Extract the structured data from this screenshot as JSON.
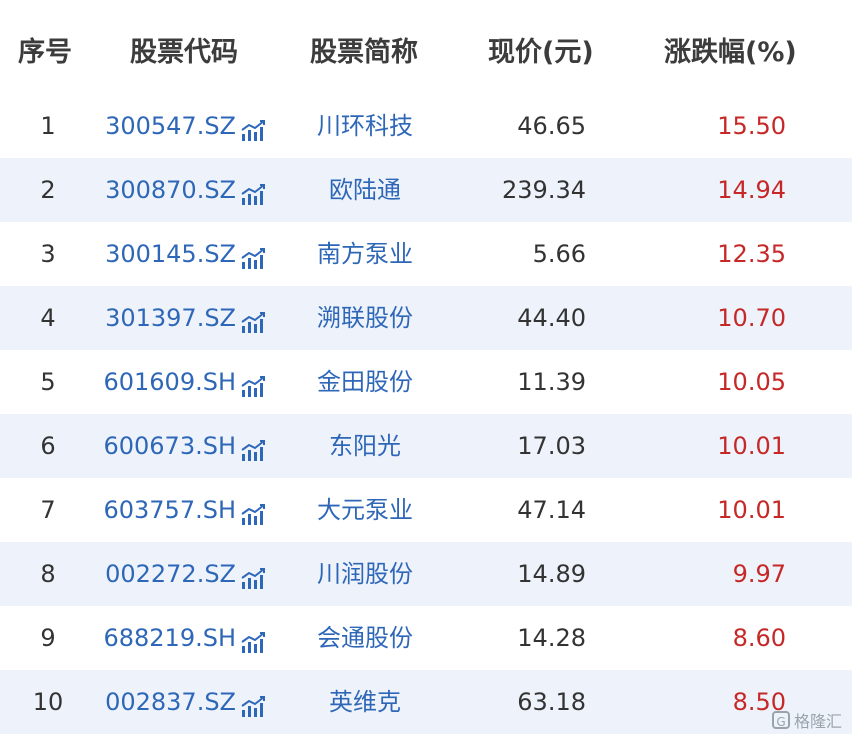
{
  "columns": {
    "index": "序号",
    "code": "股票代码",
    "name": "股票简称",
    "price": "现价(元)",
    "change": "涨跌幅(%)"
  },
  "icons": {
    "chart_icon": "trend-chart-icon",
    "icon_color": "#2f67b8"
  },
  "colors": {
    "code_link": "#2f67b8",
    "up": "#c62828",
    "stripe": "#eef3fb"
  },
  "rows": [
    {
      "index": "1",
      "code": "300547.SZ",
      "name": "川环科技",
      "price": "46.65",
      "change": "15.50"
    },
    {
      "index": "2",
      "code": "300870.SZ",
      "name": "欧陆通",
      "price": "239.34",
      "change": "14.94"
    },
    {
      "index": "3",
      "code": "300145.SZ",
      "name": "南方泵业",
      "price": "5.66",
      "change": "12.35"
    },
    {
      "index": "4",
      "code": "301397.SZ",
      "name": "溯联股份",
      "price": "44.40",
      "change": "10.70"
    },
    {
      "index": "5",
      "code": "601609.SH",
      "name": "金田股份",
      "price": "11.39",
      "change": "10.05"
    },
    {
      "index": "6",
      "code": "600673.SH",
      "name": "东阳光",
      "price": "17.03",
      "change": "10.01"
    },
    {
      "index": "7",
      "code": "603757.SH",
      "name": "大元泵业",
      "price": "47.14",
      "change": "10.01"
    },
    {
      "index": "8",
      "code": "002272.SZ",
      "name": "川润股份",
      "price": "14.89",
      "change": "9.97"
    },
    {
      "index": "9",
      "code": "688219.SH",
      "name": "会通股份",
      "price": "14.28",
      "change": "8.60"
    },
    {
      "index": "10",
      "code": "002837.SZ",
      "name": "英维克",
      "price": "63.18",
      "change": "8.50"
    }
  ],
  "watermark": {
    "logo_text": "G",
    "text": "格隆汇"
  }
}
